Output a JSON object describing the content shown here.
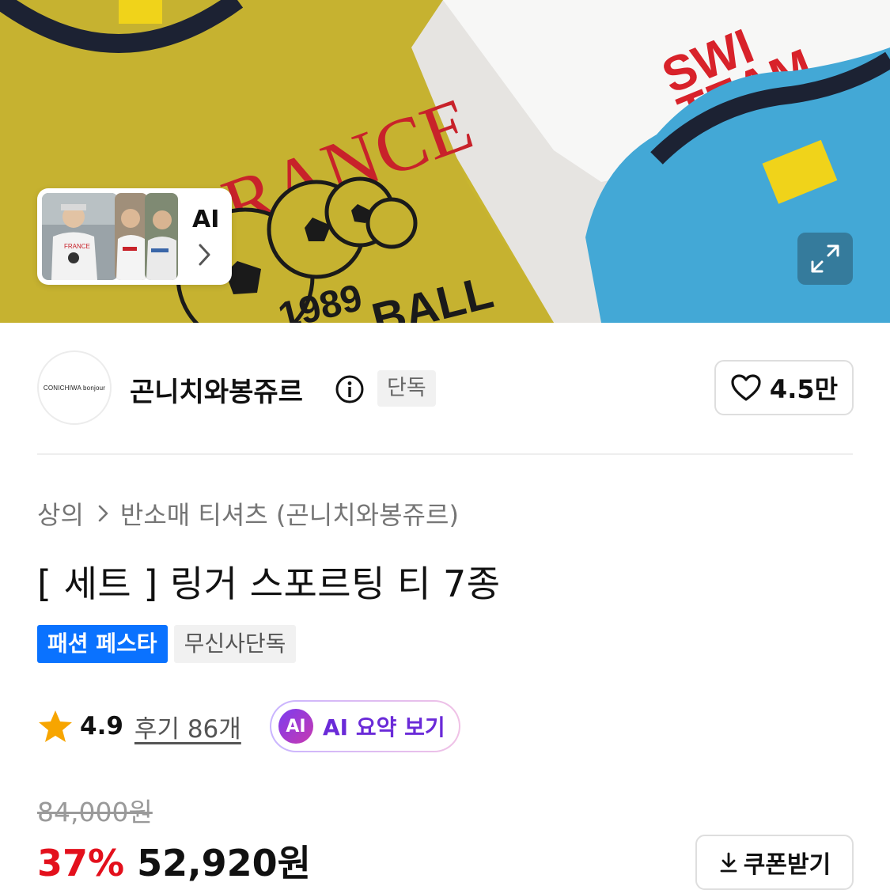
{
  "hero": {
    "ai_card": {
      "label": "AI"
    },
    "expand_icon": "expand-icon"
  },
  "brand": {
    "logo_text": "CONICHIWA bonjour",
    "name": "곤니치와봉쥬르",
    "exclusive_badge": "단독",
    "like_count": "4.5만"
  },
  "breadcrumb": {
    "category": "상의",
    "subcategory": "반소매 티셔츠 (곤니치와봉쥬르)"
  },
  "product": {
    "title": "[ 세트 ] 링거 스포르팅 티 7종",
    "tags": [
      "패션 페스타",
      "무신사단독"
    ]
  },
  "rating": {
    "value": "4.9",
    "reviews": "후기 86개",
    "ai_badge": "AI",
    "ai_summary": "AI 요약 보기"
  },
  "price": {
    "original": "84,000원",
    "discount": "37%",
    "final": "52,920원",
    "coupon": "쿠폰받기"
  },
  "colors": {
    "accent_blue": "#0a72ff",
    "discount_red": "#e3101c",
    "ai_purple": "#6a2ad8",
    "star": "#f7a500"
  },
  "icons": [
    "info-icon",
    "heart-icon",
    "star-icon",
    "chevron-right-icon",
    "download-icon",
    "expand-icon"
  ]
}
